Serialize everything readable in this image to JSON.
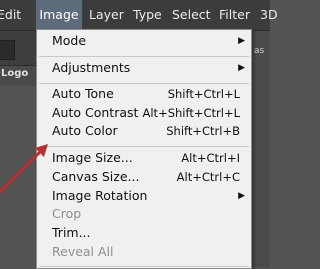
{
  "menubar": {
    "items": [
      "Edit",
      "Image",
      "Layer",
      "Type",
      "Select",
      "Filter",
      "3D"
    ]
  },
  "left_panel": {
    "tab_label": "Logo"
  },
  "right_panel": {
    "partial_label": "as"
  },
  "image_menu": {
    "items": [
      {
        "label": "Mode",
        "submenu": true
      },
      {
        "label": "Adjustments",
        "submenu": true
      },
      {
        "label": "Auto Tone",
        "shortcut": "Shift+Ctrl+L"
      },
      {
        "label": "Auto Contrast",
        "shortcut": "Alt+Shift+Ctrl+L"
      },
      {
        "label": "Auto Color",
        "shortcut": "Shift+Ctrl+B"
      },
      {
        "label": "Image Size...",
        "shortcut": "Alt+Ctrl+I"
      },
      {
        "label": "Canvas Size...",
        "shortcut": "Alt+Ctrl+C"
      },
      {
        "label": "Image Rotation",
        "submenu": true
      },
      {
        "label": "Crop",
        "disabled": true
      },
      {
        "label": "Trim..."
      },
      {
        "label": "Reveal All",
        "disabled": true
      }
    ],
    "submenu_arrow": "▶"
  },
  "colors": {
    "menubar_bg": "#3c3c3c",
    "menu_bg": "#f0f0f0",
    "active_menu_bg": "#5e6b7a",
    "annotation_arrow": "#c0392b"
  },
  "icons": {
    "annotation": "red-arrow-icon"
  }
}
